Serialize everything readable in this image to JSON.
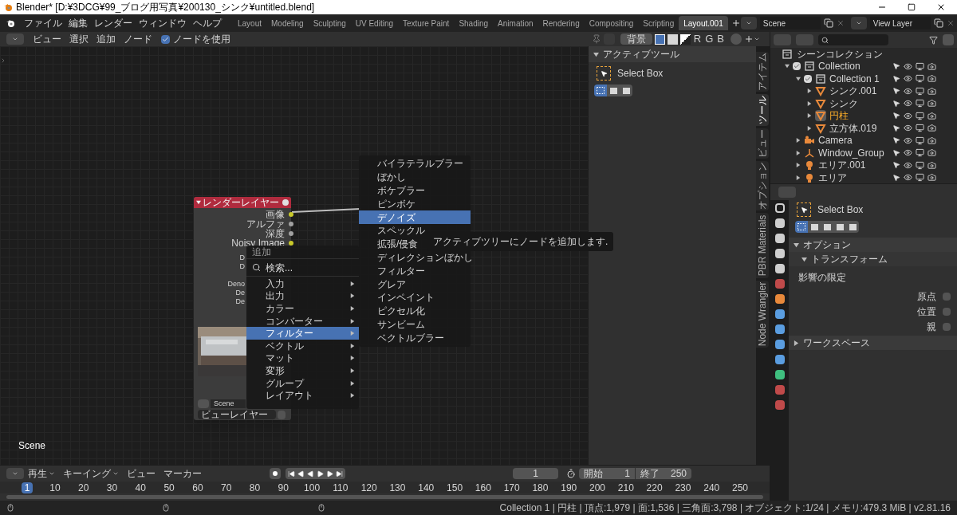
{
  "title_bar": {
    "title": "Blender* [D:¥3DCG¥99_ブログ用写真¥200130_シンク¥untitled.blend]"
  },
  "menu_bar": [
    "ファイル",
    "編集",
    "レンダー",
    "ウィンドウ",
    "ヘルプ"
  ],
  "workspace_tabs": [
    {
      "label": "Layout",
      "selected": false
    },
    {
      "label": "Modeling",
      "selected": false
    },
    {
      "label": "Sculpting",
      "selected": false
    },
    {
      "label": "UV Editing",
      "selected": false
    },
    {
      "label": "Texture Paint",
      "selected": false
    },
    {
      "label": "Shading",
      "selected": false
    },
    {
      "label": "Animation",
      "selected": false
    },
    {
      "label": "Rendering",
      "selected": false
    },
    {
      "label": "Compositing",
      "selected": false
    },
    {
      "label": "Scripting",
      "selected": false
    },
    {
      "label": "Layout.001",
      "selected": true
    }
  ],
  "scene": "Scene",
  "view_layer": "View Layer",
  "node_header": {
    "menus": [
      "ビュー",
      "選択",
      "追加",
      "ノード"
    ],
    "use_nodes": {
      "label": "ノードを使用",
      "checked": true
    },
    "backdrop": "背景",
    "channels": [
      "R",
      "G",
      "B"
    ]
  },
  "node": {
    "title": "レンダーレイヤー",
    "outputs": [
      {
        "label": "画像",
        "color": "#c8c82a"
      },
      {
        "label": "アルファ",
        "color": "#a1a1a1"
      },
      {
        "label": "深度",
        "color": "#a1a1a1"
      },
      {
        "label": "Noisy Image",
        "color": "#c8c82a"
      }
    ],
    "hidden_rows": [
      "D",
      "D",
      "Deno",
      "De",
      "De"
    ],
    "scene": "Scene",
    "layer": "ビューレイヤー"
  },
  "add_menu": {
    "title": "追加",
    "search": "検索...",
    "items": [
      {
        "label": "入力",
        "selected": false
      },
      {
        "label": "出力",
        "selected": false
      },
      {
        "label": "カラー",
        "selected": false
      },
      {
        "label": "コンバーター",
        "selected": false
      },
      {
        "label": "フィルター",
        "selected": true
      },
      {
        "label": "ベクトル",
        "selected": false
      },
      {
        "label": "マット",
        "selected": false
      },
      {
        "label": "変形",
        "selected": false
      },
      {
        "label": "グループ",
        "selected": false
      },
      {
        "label": "レイアウト",
        "selected": false
      }
    ]
  },
  "filter_menu": [
    {
      "label": "バイラテラルブラー",
      "selected": false
    },
    {
      "label": "ぼかし",
      "selected": false
    },
    {
      "label": "ボケブラー",
      "selected": false
    },
    {
      "label": "ピンボケ",
      "selected": false
    },
    {
      "label": "デノイズ",
      "selected": true
    },
    {
      "label": "スペックル",
      "selected": false
    },
    {
      "label": "拡張/侵食",
      "selected": false
    },
    {
      "label": "ディレクションぼかし",
      "selected": false
    },
    {
      "label": "フィルター",
      "selected": false
    },
    {
      "label": "グレア",
      "selected": false
    },
    {
      "label": "インペイント",
      "selected": false
    },
    {
      "label": "ピクセル化",
      "selected": false
    },
    {
      "label": "サンビーム",
      "selected": false
    },
    {
      "label": "ベクトルブラー",
      "selected": false
    }
  ],
  "tooltip": "アクティブツリーにノードを追加します.",
  "canvas_label": "Scene",
  "sidebar": {
    "panel_title": "アクティブツール",
    "tool": "Select Box",
    "tabs": [
      {
        "label": "アイテム",
        "selected": false
      },
      {
        "label": "ツール",
        "selected": true
      },
      {
        "label": "ビュー",
        "selected": false
      },
      {
        "label": "オプション",
        "selected": false
      },
      {
        "label": "PBR Materials",
        "selected": false
      },
      {
        "label": "Node Wrangler",
        "selected": false
      }
    ]
  },
  "outliner": {
    "root": "シーンコレクション",
    "tree": [
      {
        "name": "Collection",
        "kind": "collection",
        "checked": true,
        "expanded": true,
        "selected": false,
        "children": [
          {
            "name": "Collection 1",
            "kind": "collection",
            "checked": true,
            "expanded": true,
            "selected": false,
            "children": [
              {
                "name": "シンク.001",
                "kind": "mesh",
                "expanded": false,
                "selected": false
              },
              {
                "name": "シンク",
                "kind": "mesh",
                "expanded": false,
                "selected": false
              },
              {
                "name": "円柱",
                "kind": "mesh",
                "expanded": false,
                "selected": true
              },
              {
                "name": "立方体.019",
                "kind": "mesh",
                "expanded": false,
                "selected": false
              }
            ]
          },
          {
            "name": "Camera",
            "kind": "camera",
            "expanded": false,
            "selected": false
          },
          {
            "name": "Window_Group",
            "kind": "empty",
            "expanded": false,
            "selected": false
          },
          {
            "name": "エリア.001",
            "kind": "light",
            "expanded": false,
            "selected": false
          },
          {
            "name": "エリア",
            "kind": "light",
            "expanded": false,
            "selected": false
          }
        ]
      }
    ]
  },
  "properties": {
    "tool": "Select Box",
    "options": {
      "title": "オプション",
      "expanded": true,
      "sub_title": "トランスフォーム",
      "section": "影響の限定",
      "checks": [
        {
          "label": "原点",
          "checked": false
        },
        {
          "label": "位置",
          "checked": false
        },
        {
          "label": "親",
          "checked": false
        }
      ]
    },
    "workspace": {
      "title": "ワークスペース",
      "expanded": false
    }
  },
  "timeline": {
    "menus": [
      "再生",
      "キーイング",
      "ビュー",
      "マーカー"
    ],
    "current_frame": "1",
    "start_label": "開始",
    "start": "1",
    "end_label": "終了",
    "end": "250",
    "ruler": [
      {
        "label": "1",
        "selected": true
      },
      {
        "label": "10",
        "selected": false
      },
      {
        "label": "20",
        "selected": false
      },
      {
        "label": "30",
        "selected": false
      },
      {
        "label": "40",
        "selected": false
      },
      {
        "label": "50",
        "selected": false
      },
      {
        "label": "60",
        "selected": false
      },
      {
        "label": "70",
        "selected": false
      },
      {
        "label": "80",
        "selected": false
      },
      {
        "label": "90",
        "selected": false
      },
      {
        "label": "100",
        "selected": false
      },
      {
        "label": "110",
        "selected": false
      },
      {
        "label": "120",
        "selected": false
      },
      {
        "label": "130",
        "selected": false
      },
      {
        "label": "140",
        "selected": false
      },
      {
        "label": "150",
        "selected": false
      },
      {
        "label": "160",
        "selected": false
      },
      {
        "label": "170",
        "selected": false
      },
      {
        "label": "180",
        "selected": false
      },
      {
        "label": "190",
        "selected": false
      },
      {
        "label": "200",
        "selected": false
      },
      {
        "label": "210",
        "selected": false
      },
      {
        "label": "220",
        "selected": false
      },
      {
        "label": "230",
        "selected": false
      },
      {
        "label": "240",
        "selected": false
      },
      {
        "label": "250",
        "selected": false
      }
    ]
  },
  "status_bar": "Collection 1 | 円柱 | 頂点:1,979 | 面:1,536 | 三角面:3,798 | オブジェクト:1/24 | メモリ:479.3 MiB | v2.81.16"
}
